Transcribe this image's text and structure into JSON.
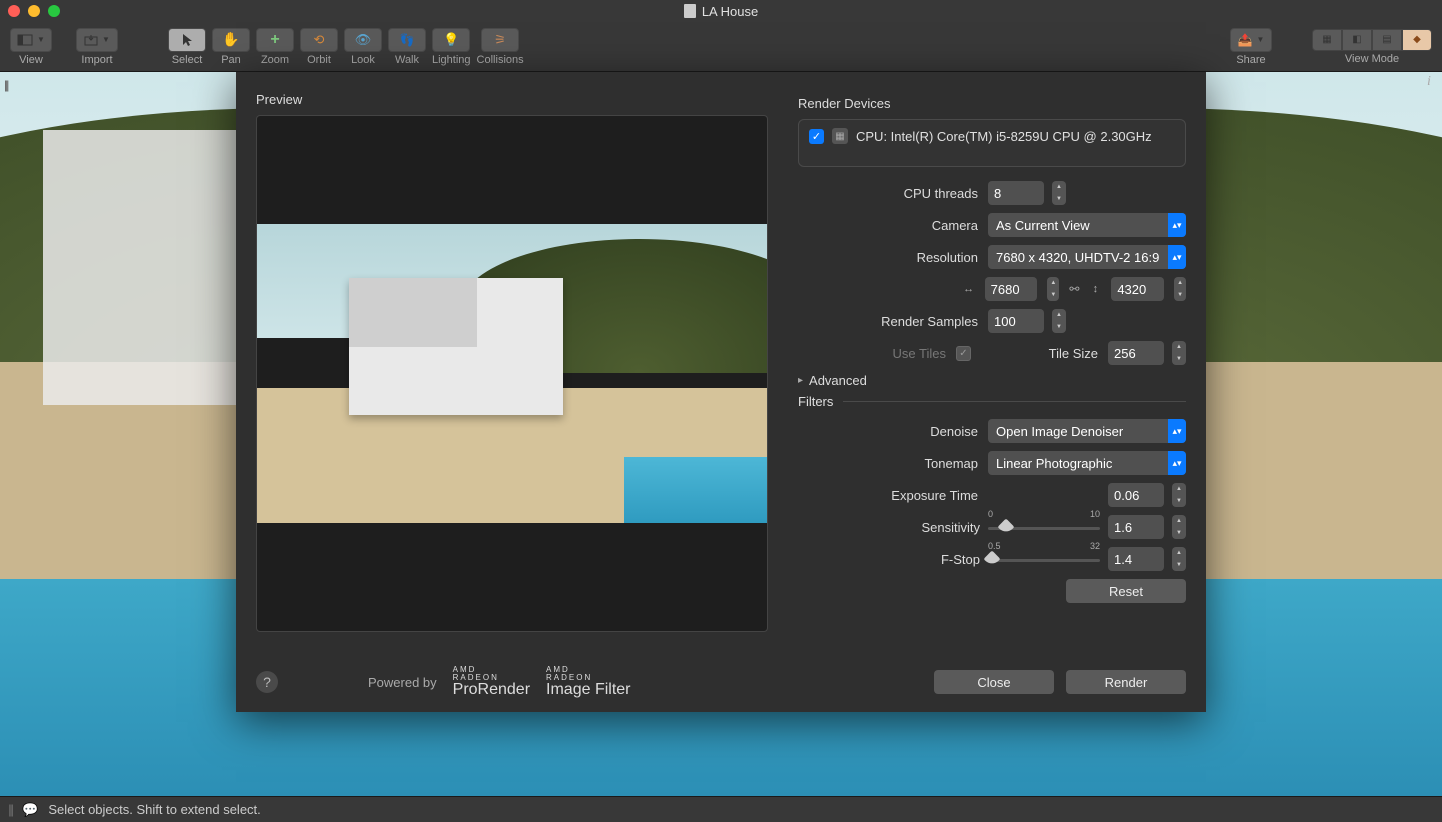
{
  "window": {
    "title": "LA House"
  },
  "toolbar": {
    "view": "View",
    "import": "Import",
    "select": "Select",
    "pan": "Pan",
    "zoom": "Zoom",
    "orbit": "Orbit",
    "look": "Look",
    "walk": "Walk",
    "lighting": "Lighting",
    "collisions": "Collisions",
    "share": "Share",
    "view_mode": "View Mode"
  },
  "dialog": {
    "preview_title": "Preview",
    "devices_title": "Render Devices",
    "device_cpu": "CPU: Intel(R) Core(TM) i5-8259U CPU @ 2.30GHz",
    "cpu_threads_label": "CPU threads",
    "cpu_threads_value": "8",
    "camera_label": "Camera",
    "camera_value": "As Current View",
    "resolution_label": "Resolution",
    "resolution_value": "7680 x 4320, UHDTV-2 16:9",
    "width_value": "7680",
    "height_value": "4320",
    "samples_label": "Render Samples",
    "samples_value": "100",
    "use_tiles_label": "Use Tiles",
    "tile_size_label": "Tile Size",
    "tile_size_value": "256",
    "advanced_label": "Advanced",
    "filters_label": "Filters",
    "denoise_label": "Denoise",
    "denoise_value": "Open Image Denoiser",
    "tonemap_label": "Tonemap",
    "tonemap_value": "Linear Photographic",
    "exposure_label": "Exposure Time",
    "exposure_value": "0.06",
    "sensitivity_label": "Sensitivity",
    "sensitivity_min": "0",
    "sensitivity_max": "10",
    "sensitivity_value": "1.6",
    "fstop_label": "F-Stop",
    "fstop_min": "0.5",
    "fstop_max": "32",
    "fstop_value": "1.4",
    "reset_label": "Reset",
    "powered_by": "Powered by",
    "brand1_micro": "AMD",
    "brand1_mid": "RADEON",
    "brand1_name": "ProRender",
    "brand2_micro": "AMD",
    "brand2_mid": "RADEON",
    "brand2_name": "Image Filter",
    "close_label": "Close",
    "render_label": "Render"
  },
  "status": {
    "hint": "Select objects. Shift to extend select."
  }
}
